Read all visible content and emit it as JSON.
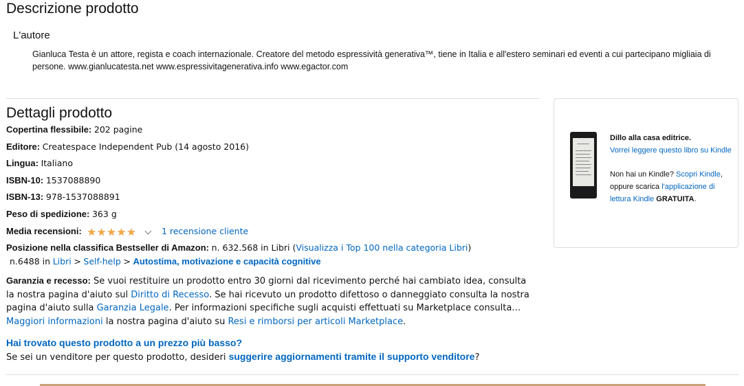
{
  "description": {
    "title": "Descrizione prodotto",
    "author_heading": "L'autore",
    "author_bio": "Gianluca Testa è un attore, regista e coach internazionale. Creatore del metodo espressività generativa™, tiene in Italia e all'estero seminari ed eventi a cui partecipano migliaia di persone. www.gianlucatesta.net www.espressivitagenerativa.info www.egactor.com"
  },
  "details": {
    "title": "Dettagli prodotto",
    "binding_label": "Copertina flessibile:",
    "binding_value": "202 pagine",
    "publisher_label": "Editore:",
    "publisher_value": "Createspace Independent Pub (14 agosto 2016)",
    "language_label": "Lingua:",
    "language_value": "Italiano",
    "isbn10_label": "ISBN-10:",
    "isbn10_value": "1537088890",
    "isbn13_label": "ISBN-13:",
    "isbn13_value": "978-1537088891",
    "weight_label": "Peso di spedizione:",
    "weight_value": "363 g",
    "reviews_label": "Media recensioni:",
    "rating_stars": 5,
    "review_count_link": "1 recensione cliente",
    "rank_label": "Posizione nella classifica Bestseller di Amazon:",
    "rank_value": "n. 632.568 in Libri (",
    "rank_top100_link": "Visualizza i Top 100 nella categoria Libri",
    "rank_close": ")",
    "subrank_prefix": "n.6488 in",
    "subrank_cat1": "Libri",
    "subrank_sep": ">",
    "subrank_cat2": "Self-help",
    "subrank_cat3": "Autostima, motivazione e capacità cognitive"
  },
  "warranty": {
    "label": "Garanzia e recesso:",
    "text1": "Se vuoi restituire un prodotto entro 30 giorni dal ricevimento perché hai cambiato idea, consulta la nostra pagina d'aiuto sul",
    "link_recesso": "Diritto di Recesso",
    "text2": ". Se hai ricevuto un prodotto difettoso o danneggiato consulta la nostra pagina d'aiuto sulla",
    "link_garanzia": "Garanzia Legale",
    "text3": ". Per informazioni specifiche sugli acquisti effettuati su Marketplace consulta…",
    "link_more": "Maggiori informazioni",
    "text4": "la nostra pagina d'aiuto su",
    "link_resi": "Resi e rimborsi per articoli Marketplace",
    "text5": "."
  },
  "feedback": {
    "lower_price_link": "Hai trovato questo prodotto a un prezzo più basso?",
    "seller_text": "Se sei un venditore per questo prodotto, desideri",
    "seller_link": "suggerire aggiornamenti tramite il supporto venditore",
    "seller_end": "?"
  },
  "kindle": {
    "tell_publisher": "Dillo alla casa editrice.",
    "request_link": "Vorrei leggere questo libro su Kindle",
    "no_kindle_text": "Non hai un Kindle?",
    "discover_link": "Scopri Kindle",
    "or_download": ", oppure scarica",
    "app_link": "l'applicazione di lettura Kindle",
    "free": "GRATUITA",
    "period": "."
  },
  "colors": {
    "link": "#0066c0",
    "star": "#f3a847"
  }
}
